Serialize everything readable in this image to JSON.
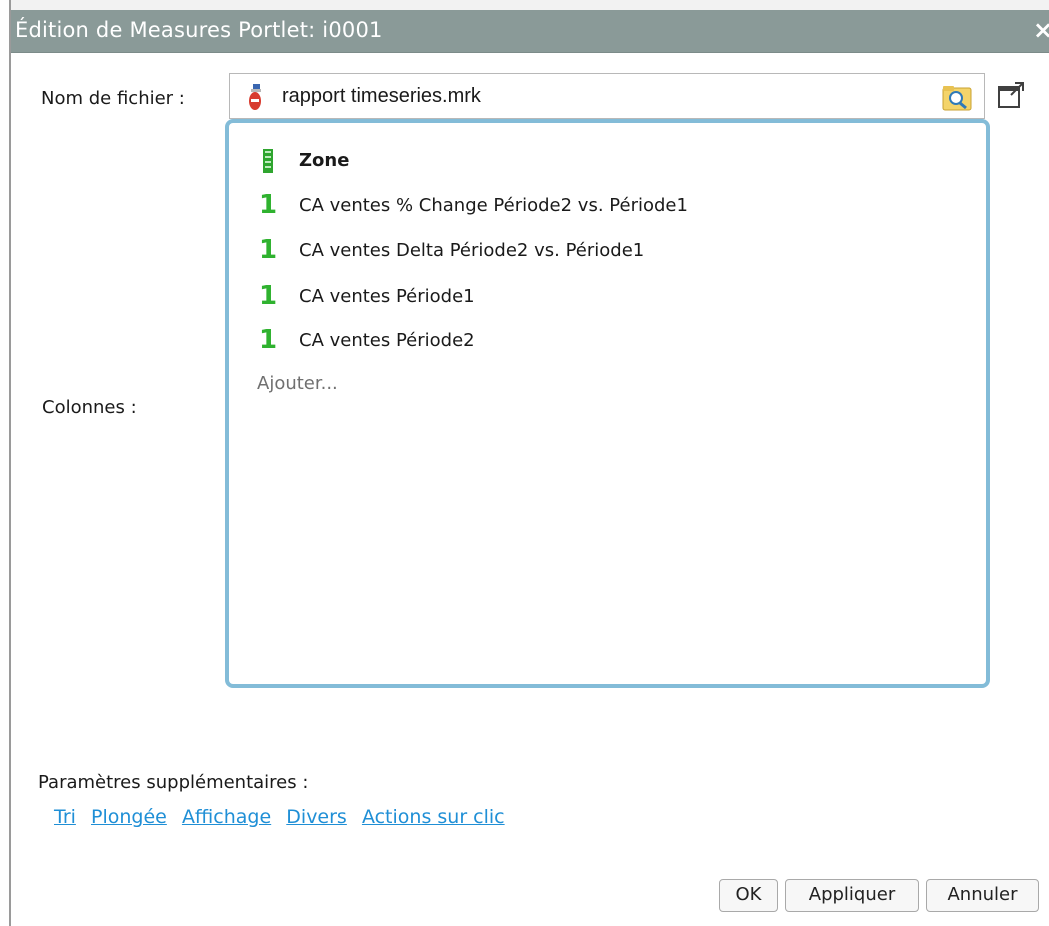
{
  "dialog": {
    "title": "Édition de Measures Portlet: i0001",
    "close_symbol": "×"
  },
  "file": {
    "label": "Nom de fichier :",
    "value": "rapport timeseries.mrk",
    "icon": "report-file-icon",
    "browse_icon": "folder-search-icon",
    "popout_icon": "open-external-icon"
  },
  "columns": {
    "label": "Colonnes :",
    "items": [
      {
        "icon": "zone-dimension-icon",
        "text": "Zone",
        "bold": true
      },
      {
        "icon": "measure-icon",
        "icon_text": "1",
        "text": "CA ventes % Change Période2 vs. Période1"
      },
      {
        "icon": "measure-icon",
        "icon_text": "1",
        "text": "CA ventes Delta Période2 vs. Période1"
      },
      {
        "icon": "measure-icon",
        "icon_text": "1",
        "text": "CA ventes Période1"
      },
      {
        "icon": "measure-icon",
        "icon_text": "1",
        "text": "CA ventes Période2"
      }
    ],
    "add_text": "Ajouter..."
  },
  "params": {
    "label": "Paramètres supplémentaires :",
    "links": [
      "Tri",
      "Plongée",
      "Affichage",
      "Divers",
      "Actions sur clic"
    ]
  },
  "buttons": {
    "ok": "OK",
    "apply": "Appliquer",
    "cancel": "Annuler"
  },
  "colors": {
    "titlebar": "#8a9a98",
    "columns_border": "#83bcd8",
    "measure_icon": "#2fb22f",
    "link": "#1f8fd6"
  }
}
